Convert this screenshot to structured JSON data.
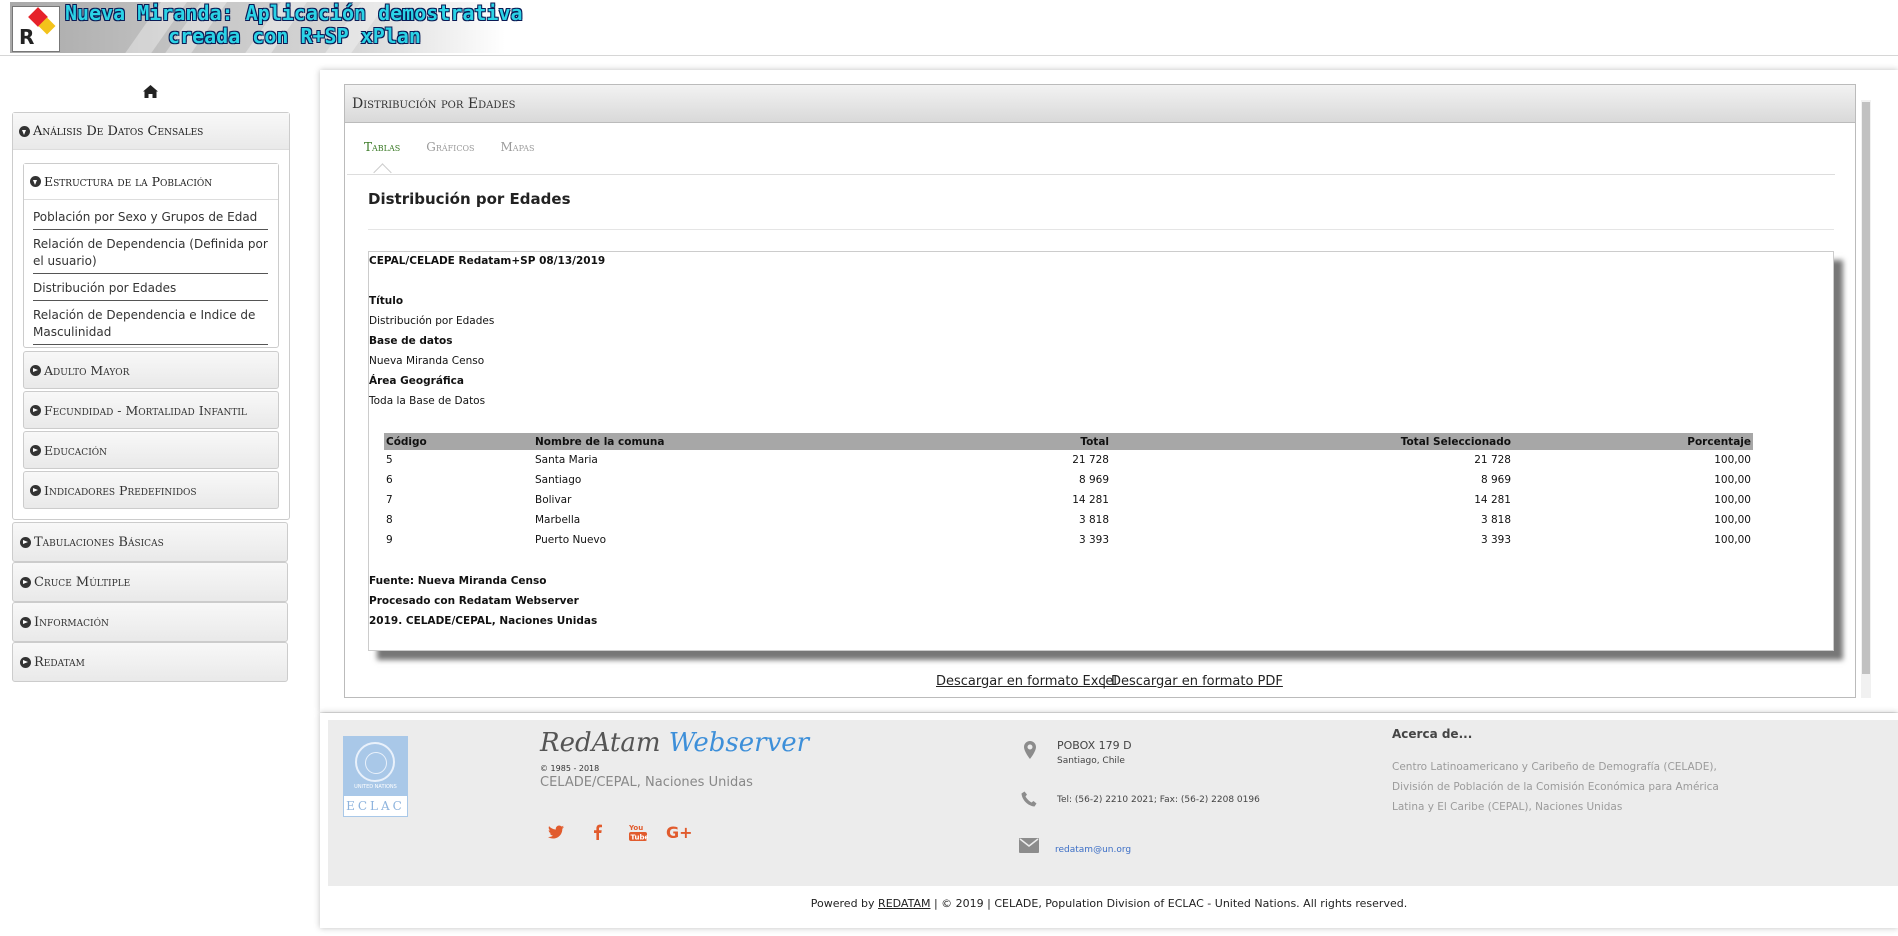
{
  "header": {
    "title_line1": "Nueva Miranda: Aplicación demostrativa",
    "title_line2": "creada con R+SP xPlan"
  },
  "sidebar": {
    "home_icon": "home-icon",
    "sections": [
      {
        "label": "Análisis De Datos Censales",
        "state": "open"
      },
      {
        "label": "Tabulaciones Básicas",
        "state": "closed"
      },
      {
        "label": "Cruce Múltiple",
        "state": "closed"
      },
      {
        "label": "Información",
        "state": "closed"
      },
      {
        "label": "Redatam",
        "state": "closed"
      }
    ],
    "subsections": [
      {
        "label": "Estructura de la Población",
        "state": "open"
      },
      {
        "label": "Adulto Mayor",
        "state": "closed"
      },
      {
        "label": "Fecundidad - Mortalidad Infantil",
        "state": "closed"
      },
      {
        "label": "Educación",
        "state": "closed"
      },
      {
        "label": "Indicadores Predefinidos",
        "state": "closed"
      }
    ],
    "links": [
      "Población por Sexo y Grupos de Edad",
      "Relación de Dependencia (Definida por el usuario)",
      "Distribución por Edades",
      "Relación de Dependencia e Indice de Masculinidad"
    ]
  },
  "main": {
    "panel_title": "Distribución por Edades",
    "tabs": [
      {
        "label": "Tablas",
        "active": true
      },
      {
        "label": "Gráficos",
        "active": false
      },
      {
        "label": "Mapas",
        "active": false
      }
    ],
    "content_title": "Distribución por Edades",
    "report": {
      "header": "CEPAL/CELADE Redatam+SP 08/13/2019",
      "titulo_label": "Título",
      "titulo_value": "Distribución por Edades",
      "base_label": "Base de datos",
      "base_value": "Nueva Miranda Censo",
      "area_label": "Área Geográfica",
      "area_value": "Toda la Base de Datos",
      "table": {
        "columns": [
          "Código",
          "Nombre de la comuna",
          "Total",
          "Total Seleccionado",
          "Porcentaje"
        ],
        "rows": [
          [
            "5",
            "Santa Maria",
            "21 728",
            "21 728",
            "100,00"
          ],
          [
            "6",
            "Santiago",
            "8 969",
            "8 969",
            "100,00"
          ],
          [
            "7",
            "Bolivar",
            "14 281",
            "14 281",
            "100,00"
          ],
          [
            "8",
            "Marbella",
            "3 818",
            "3 818",
            "100,00"
          ],
          [
            "9",
            "Puerto Nuevo",
            "3 393",
            "3 393",
            "100,00"
          ]
        ]
      },
      "fuente": "Fuente: Nueva Miranda Censo",
      "procesado": "Procesado con Redatam Webserver",
      "copyright": "2019. CELADE/CEPAL, Naciones Unidas"
    },
    "download_excel": "Descargar en formato Excel",
    "download_sep": "|",
    "download_pdf": "Descargar en formato PDF"
  },
  "footer": {
    "logo_text_un": "UNITED NATIONS",
    "logo_text_eclac": "ECLAC",
    "brand_redatam": "RedAtam",
    "brand_webserver": "Webserver",
    "years": "© 1985 - 2018",
    "org": "CELADE/CEPAL, Naciones Unidas",
    "social": [
      "twitter-icon",
      "facebook-icon",
      "youtube-icon",
      "google-plus-icon"
    ],
    "address_line1": "POBOX 179 D",
    "address_line2": "Santiago, Chile",
    "phone": "Tel: (56-2) 2210 2021; Fax: (56-2) 2208 0196",
    "email": "redatam@un.org",
    "about_title": "Acerca de...",
    "about_text": "Centro Latinoamericano y Caribeño de Demografía (CELADE), División de Población de la Comisión Económica para América Latina y El Caribe (CEPAL), Naciones Unidas",
    "powered_prefix": "Powered by",
    "powered_link": "REDATAM",
    "powered_suffix": "| © 2019 | CELADE, Population Division of ECLAC - United Nations. All rights reserved."
  },
  "colors": {
    "accent_green": "#3a7a26",
    "social_orange": "#e15b2d",
    "banner_title": "#2bd3e6",
    "link_blue": "#3d8fd9"
  }
}
